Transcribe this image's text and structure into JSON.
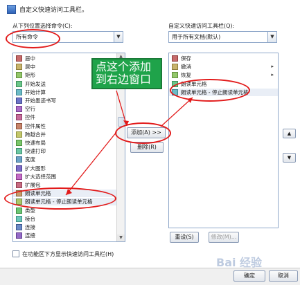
{
  "header": {
    "title": "自定义快速访问工具栏。"
  },
  "left": {
    "choose_label": "从下列位置选择命令(C):",
    "combo_value": "所有命令",
    "items": [
      {
        "label": "居中",
        "arrow": ""
      },
      {
        "label": "居中",
        "arrow": ""
      },
      {
        "label": "矩形",
        "arrow": ""
      },
      {
        "label": "开始发送",
        "arrow": ""
      },
      {
        "label": "开始计算",
        "arrow": ""
      },
      {
        "label": "开始墨迹书写",
        "arrow": ""
      },
      {
        "label": "空行",
        "arrow": "▸"
      },
      {
        "label": "控件",
        "arrow": "▸"
      },
      {
        "label": "控件属性",
        "arrow": ""
      },
      {
        "label": "跨越合并",
        "arrow": ""
      },
      {
        "label": "快速布局",
        "arrow": "▸"
      },
      {
        "label": "快速打印",
        "arrow": ""
      },
      {
        "label": "宽度",
        "arrow": ""
      },
      {
        "label": "扩大图形",
        "arrow": ""
      },
      {
        "label": "扩大选择范围",
        "arrow": ""
      },
      {
        "label": "扩展包",
        "arrow": ""
      },
      {
        "label": "朗读单元格",
        "arrow": ""
      },
      {
        "label": "朗读单元格 - 停止朗读单元格",
        "arrow": ""
      },
      {
        "label": "类型",
        "arrow": "▸"
      },
      {
        "label": "棱台",
        "arrow": "▸"
      },
      {
        "label": "连接",
        "arrow": ""
      },
      {
        "label": "连接",
        "arrow": "▸"
      }
    ]
  },
  "right": {
    "customize_label": "自定义快速访问工具栏(Q):",
    "combo_value": "用于所有文档(默认)",
    "items": [
      {
        "label": "保存",
        "arrow": ""
      },
      {
        "label": "撤消",
        "arrow": "▸"
      },
      {
        "label": "恢复",
        "arrow": "▸"
      },
      {
        "label": "朗读单元格",
        "arrow": ""
      },
      {
        "label": "朗读单元格 - 停止朗读单元格",
        "arrow": ""
      }
    ],
    "reset_label": "重设(S)",
    "modify_label": "修改(M)..."
  },
  "middle": {
    "add_label": "添加(A) >>",
    "remove_label": "删除(R)"
  },
  "annotation": {
    "text": "点这个添加到右边窗口"
  },
  "footer": {
    "checkbox_label": "在功能区下方显示快速访问工具栏(H)",
    "ok_label": "确定",
    "cancel_label": "取消"
  },
  "watermark": {
    "text": "Bai 经验"
  },
  "colors": {
    "annotation_bg": "#1fa34a",
    "highlight_ellipse": "#e21a1a"
  }
}
